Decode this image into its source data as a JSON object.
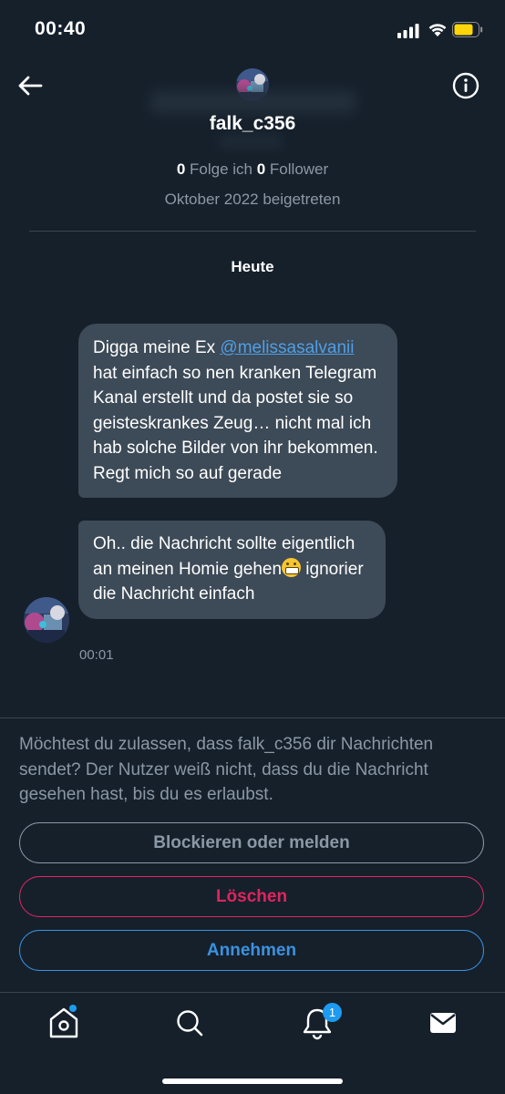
{
  "status": {
    "time": "00:40"
  },
  "profile": {
    "name": "falk_c356",
    "following_count": "0",
    "following_label": " Folge ich ",
    "followers_count": "0",
    "followers_label": " Follower",
    "joined": "Oktober 2022 beigetreten"
  },
  "day_label": "Heute",
  "messages": {
    "m1_before": "Digga meine Ex ",
    "m1_mention": "@melissasalvanii",
    "m1_after": " hat einfach so nen kranken Telegram Kanal erstellt und da postet sie so geisteskrankes Zeug… nicht mal ich hab solche Bilder von ihr bekommen. Regt mich so auf gerade",
    "m2_before": "Oh.. die Nachricht sollte eigentlich an meinen Homie gehen",
    "m2_after": " ignorier die Nachricht einfach",
    "time": "00:01"
  },
  "request": {
    "text": "Möchtest du zulassen, dass falk_c356 dir Nachrichten sendet? Der Nutzer weiß nicht, dass du die Nachricht gesehen hast, bis du es erlaubst.",
    "block_label": "Blockieren oder melden",
    "delete_label": "Löschen",
    "accept_label": "Annehmen"
  },
  "tabbar": {
    "notifications_badge": "1"
  },
  "icons": {
    "back": "back-arrow-icon",
    "info": "info-icon",
    "home": "home-icon",
    "search": "search-icon",
    "notifications": "bell-icon",
    "messages": "mail-icon",
    "emoji": "grimacing-emoji-icon"
  },
  "colors": {
    "background": "#15202b",
    "bubble": "#3d4a57",
    "accent": "#1d9bf0",
    "danger": "#e0245e",
    "muted": "#8b98a5"
  }
}
